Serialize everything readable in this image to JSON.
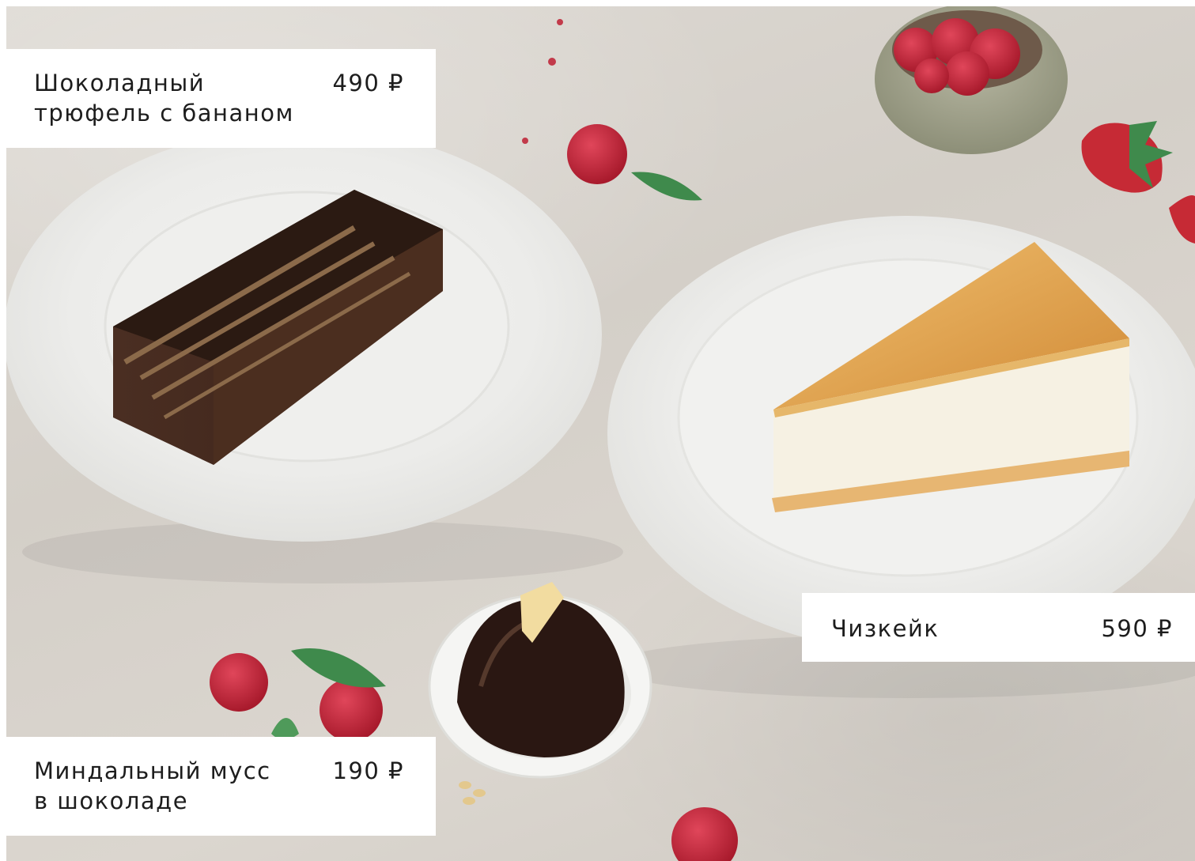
{
  "menu": {
    "items": [
      {
        "name": "Шоколадный\nтрюфель с бананом",
        "price": "490 ₽",
        "icon": "chocolate-cake-slice"
      },
      {
        "name": "Чизкейк",
        "price": "590 ₽",
        "icon": "cheesecake-slice"
      },
      {
        "name": "Миндальный мусс\nв шоколаде",
        "price": "190 ₽",
        "icon": "chocolate-mousse-dessert"
      }
    ]
  },
  "colors": {
    "tablecloth": "#d6d1ca",
    "plate": "#f4f4f3",
    "chocolate": "#3b2419",
    "cheesecake_top": "#e0a24d",
    "cheesecake_body": "#f6f1e3",
    "raspberry": "#c7283a",
    "mint": "#3f8a4c",
    "card_background": "#ffffff",
    "text": "#1d1d1d"
  }
}
